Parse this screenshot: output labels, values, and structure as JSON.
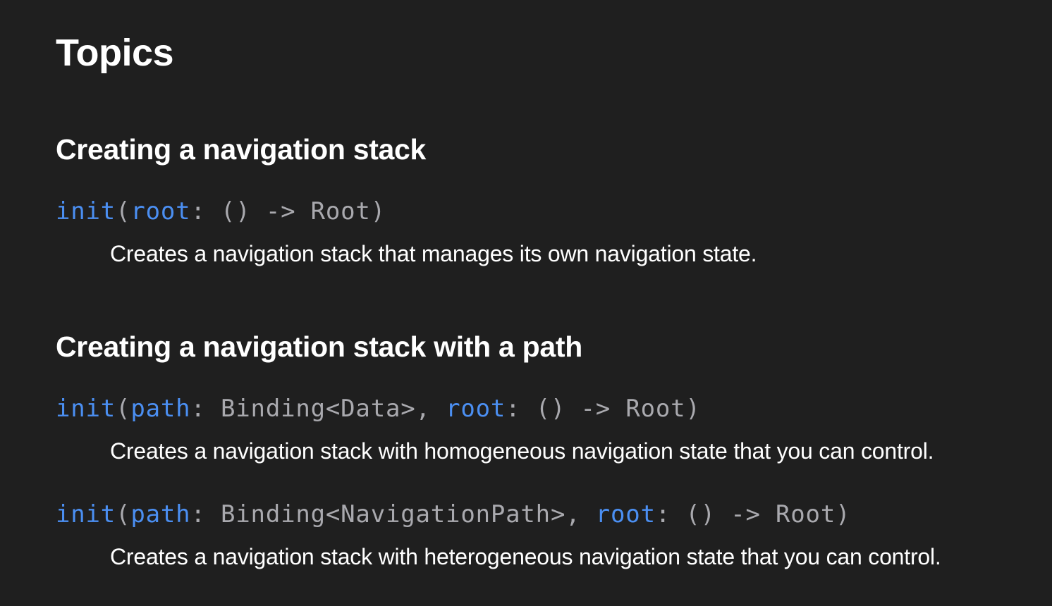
{
  "page_title": "Topics",
  "colors": {
    "background": "#1f1f1f",
    "link_keyword": "#4b8ff2",
    "code_plain": "#a9a9ae",
    "text": "#ffffff"
  },
  "sections": [
    {
      "heading": "Creating a navigation stack",
      "topics": [
        {
          "signature": [
            {
              "kind": "kw",
              "text": "init"
            },
            {
              "kind": "plain",
              "text": "("
            },
            {
              "kind": "kw",
              "text": "root"
            },
            {
              "kind": "plain",
              "text": ": () -> Root)"
            }
          ],
          "abstract": "Creates a navigation stack that manages its own navigation state."
        }
      ]
    },
    {
      "heading": "Creating a navigation stack with a path",
      "topics": [
        {
          "signature": [
            {
              "kind": "kw",
              "text": "init"
            },
            {
              "kind": "plain",
              "text": "("
            },
            {
              "kind": "kw",
              "text": "path"
            },
            {
              "kind": "plain",
              "text": ": Binding<Data>, "
            },
            {
              "kind": "kw",
              "text": "root"
            },
            {
              "kind": "plain",
              "text": ": () -> Root)"
            }
          ],
          "abstract": "Creates a navigation stack with homogeneous navigation state that you can control."
        },
        {
          "signature": [
            {
              "kind": "kw",
              "text": "init"
            },
            {
              "kind": "plain",
              "text": "("
            },
            {
              "kind": "kw",
              "text": "path"
            },
            {
              "kind": "plain",
              "text": ": Binding<NavigationPath>, "
            },
            {
              "kind": "kw",
              "text": "root"
            },
            {
              "kind": "plain",
              "text": ": () -> Root)"
            }
          ],
          "abstract": "Creates a navigation stack with heterogeneous navigation state that you can control."
        }
      ]
    }
  ]
}
